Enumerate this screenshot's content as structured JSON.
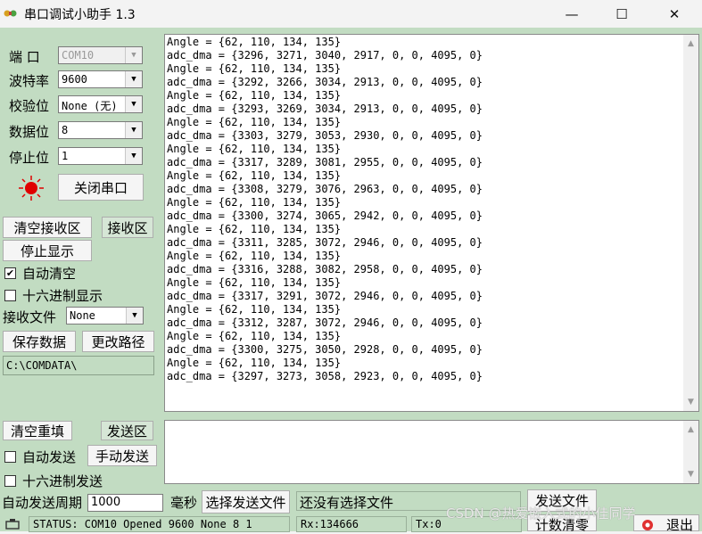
{
  "window": {
    "title": "串口调试小助手 1.3",
    "minimize": "—",
    "maximize": "☐",
    "close": "✕"
  },
  "port_settings": {
    "port_label": "端 口",
    "port_value": "COM10",
    "baud_label": "波特率",
    "baud_value": "9600",
    "parity_label": "校验位",
    "parity_value": "None (无)",
    "databits_label": "数据位",
    "databits_value": "8",
    "stopbits_label": "停止位",
    "stopbits_value": "1",
    "close_port_button": "关闭串口",
    "led_color": "#e00000"
  },
  "receive_controls": {
    "clear_button": "清空接收区",
    "area_button": "接收区",
    "stop_display_button": "停止显示",
    "auto_clear_label": "自动清空",
    "auto_clear_checked": "✔",
    "hex_display_label": "十六进制显示",
    "file_label": "接收文件",
    "file_value": "None",
    "save_button": "保存数据",
    "change_path_button": "更改路径",
    "path": "C:\\COMDATA\\"
  },
  "receive_lines": [
    "Angle = {62, 110, 134, 135}",
    "adc_dma = {3296, 3271, 3040, 2917, 0, 0, 4095, 0}",
    "Angle = {62, 110, 134, 135}",
    "adc_dma = {3292, 3266, 3034, 2913, 0, 0, 4095, 0}",
    "Angle = {62, 110, 134, 135}",
    "adc_dma = {3293, 3269, 3034, 2913, 0, 0, 4095, 0}",
    "Angle = {62, 110, 134, 135}",
    "adc_dma = {3303, 3279, 3053, 2930, 0, 0, 4095, 0}",
    "Angle = {62, 110, 134, 135}",
    "adc_dma = {3317, 3289, 3081, 2955, 0, 0, 4095, 0}",
    "Angle = {62, 110, 134, 135}",
    "adc_dma = {3308, 3279, 3076, 2963, 0, 0, 4095, 0}",
    "Angle = {62, 110, 134, 135}",
    "adc_dma = {3300, 3274, 3065, 2942, 0, 0, 4095, 0}",
    "Angle = {62, 110, 134, 135}",
    "adc_dma = {3311, 3285, 3072, 2946, 0, 0, 4095, 0}",
    "Angle = {62, 110, 134, 135}",
    "adc_dma = {3316, 3288, 3082, 2958, 0, 0, 4095, 0}",
    "Angle = {62, 110, 134, 135}",
    "adc_dma = {3317, 3291, 3072, 2946, 0, 0, 4095, 0}",
    "Angle = {62, 110, 134, 135}",
    "adc_dma = {3312, 3287, 3072, 2946, 0, 0, 4095, 0}",
    "Angle = {62, 110, 134, 135}",
    "adc_dma = {3300, 3275, 3050, 2928, 0, 0, 4095, 0}",
    "Angle = {62, 110, 134, 135}",
    "adc_dma = {3297, 3273, 3058, 2923, 0, 0, 4095, 0}"
  ],
  "send_controls": {
    "clear_resend_button": "清空重填",
    "send_area_button": "发送区",
    "auto_send_label": "自动发送",
    "manual_send_button": "手动发送",
    "hex_send_label": "十六进制发送",
    "period_label": "自动发送周期",
    "period_value": "1000",
    "ms_label": "毫秒",
    "choose_file_button": "选择发送文件",
    "file_status": "还没有选择文件",
    "send_file_button": "发送文件",
    "counter_clear_button": "计数清零",
    "exit_button": "退出"
  },
  "status_bar": {
    "status": "STATUS: COM10 Opened 9600 None  8 1",
    "rx": "Rx:134666",
    "tx": "Tx:0"
  },
  "watermark": "CSDN @热爱嵌入式的小佳同学"
}
